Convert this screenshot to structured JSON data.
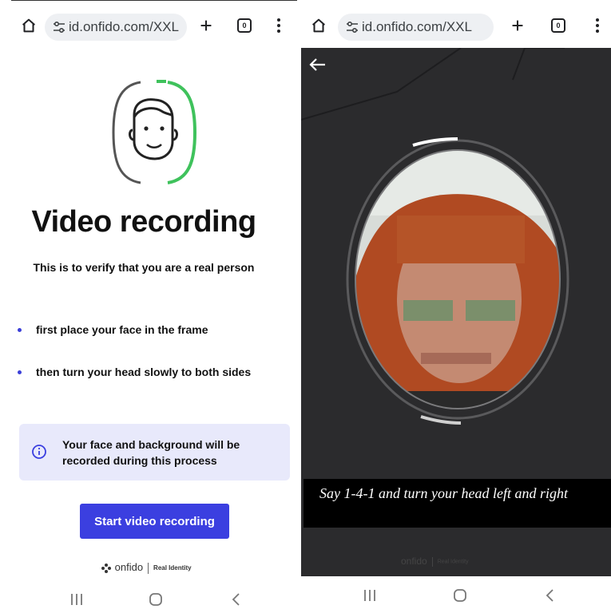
{
  "browser": {
    "url": "id.onfido.com/XXL",
    "tab_count": "0"
  },
  "intro_screen": {
    "title": "Video recording",
    "subtitle": "This is to verify that you are a real person",
    "steps": [
      "first place your face in the frame",
      "then turn your head slowly to both sides"
    ],
    "notice": "Your face and background will be recorded during this process",
    "start_button": "Start video recording",
    "brand": "onfido",
    "brand_tag": "Real Identity"
  },
  "capture_screen": {
    "caption": "Say 1-4-1 and turn your head left and right",
    "brand": "onfido",
    "brand_tag": "Real Identity"
  },
  "icons": {
    "home": "home-icon",
    "site_settings": "tune-icon",
    "new_tab": "plus-icon",
    "tabs": "tab-switcher-icon",
    "menu": "more-vert-icon",
    "info": "info-icon",
    "back": "arrow-left-icon",
    "nav_recents": "recents-icon",
    "nav_home": "nav-home-icon",
    "nav_back": "chevron-left-icon"
  },
  "colors": {
    "accent": "#3b3fe0",
    "notice_bg": "#e8e9fb",
    "progress_green": "#3fc25c"
  }
}
